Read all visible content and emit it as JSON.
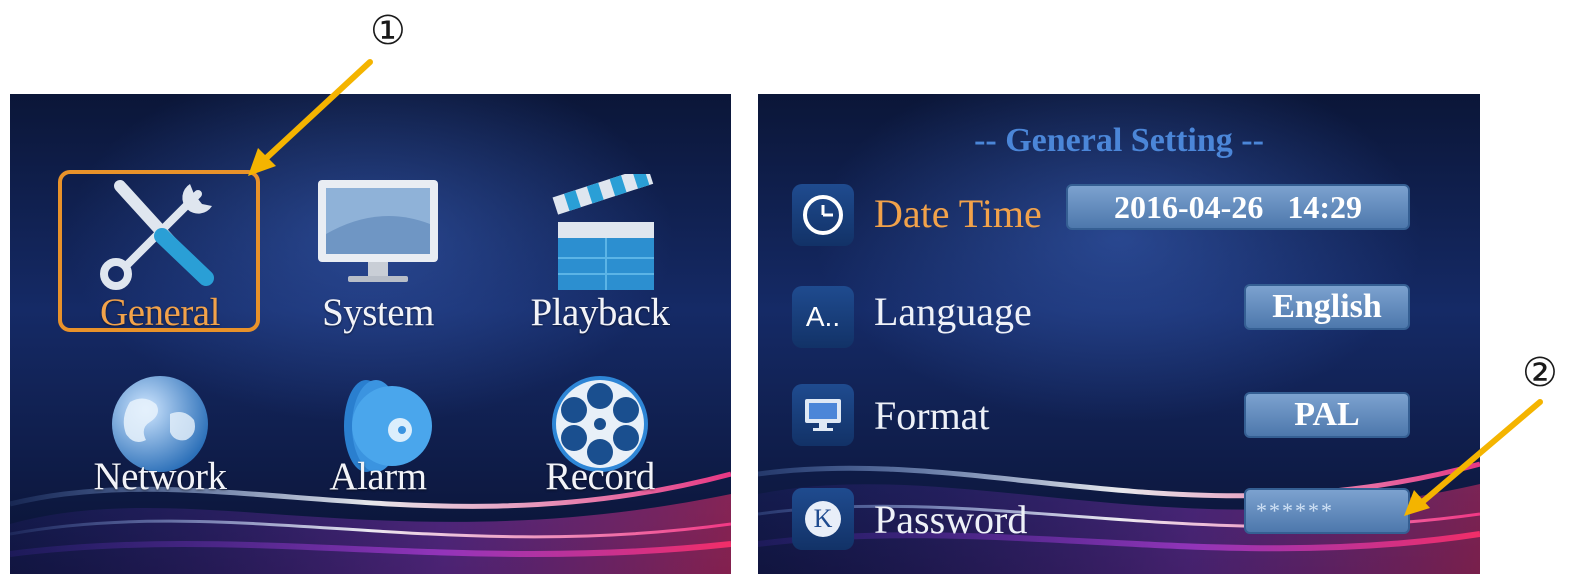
{
  "callouts": {
    "left": "①",
    "right": "②"
  },
  "main_menu": {
    "items": [
      {
        "label": "General",
        "icon": "tools-icon"
      },
      {
        "label": "System",
        "icon": "monitor-icon"
      },
      {
        "label": "Playback",
        "icon": "clapperboard-icon"
      },
      {
        "label": "Network",
        "icon": "globe-icon"
      },
      {
        "label": "Alarm",
        "icon": "alarm-disc-icon"
      },
      {
        "label": "Record",
        "icon": "film-reel-icon"
      }
    ],
    "selected": "General"
  },
  "general_setting": {
    "title": "-- General Setting --",
    "rows": [
      {
        "label": "Date Time",
        "value": "2016-04-26   14:29",
        "icon": "clock-icon"
      },
      {
        "label": "Language",
        "value": "English",
        "icon": "language-icon",
        "icon_text": "A.."
      },
      {
        "label": "Format",
        "value": "PAL",
        "icon": "monitor-small-icon"
      },
      {
        "label": "Password",
        "value": "******",
        "icon": "key-icon",
        "icon_text": "K"
      }
    ]
  },
  "colors": {
    "accent": "#e8922a",
    "heading": "#4b86d8",
    "callout_arrow": "#f4b400"
  }
}
